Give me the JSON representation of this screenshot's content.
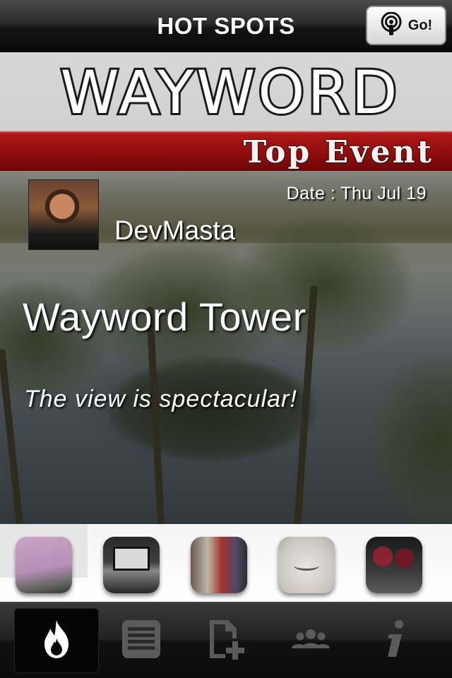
{
  "navbar": {
    "title": "HOT SPOTS",
    "go_button_label": "Go!",
    "go_button_icon": "podcast-icon"
  },
  "banner": {
    "logo": "WAYWORD",
    "ribbon": "Top Event"
  },
  "event": {
    "username": "DevMasta",
    "date": "Date : Thu Jul 19",
    "title": "Wayword Tower",
    "description": "The view is spectacular!"
  },
  "thumbnails": [
    {
      "name": "rainbow-photo"
    },
    {
      "name": "laptop-photo"
    },
    {
      "name": "bottle-photo"
    },
    {
      "name": "plush-toy-photo"
    },
    {
      "name": "wine-glasses-photo"
    }
  ],
  "tabbar": {
    "tabs": [
      {
        "icon": "flame-icon",
        "active": true
      },
      {
        "icon": "list-icon",
        "active": false
      },
      {
        "icon": "add-document-icon",
        "active": false
      },
      {
        "icon": "people-icon",
        "active": false
      },
      {
        "icon": "info-icon",
        "active": false
      }
    ]
  },
  "colors": {
    "ribbon_red": "#9a1010",
    "tab_inactive": "#5a5a5a",
    "tab_active": "#ffffff"
  }
}
